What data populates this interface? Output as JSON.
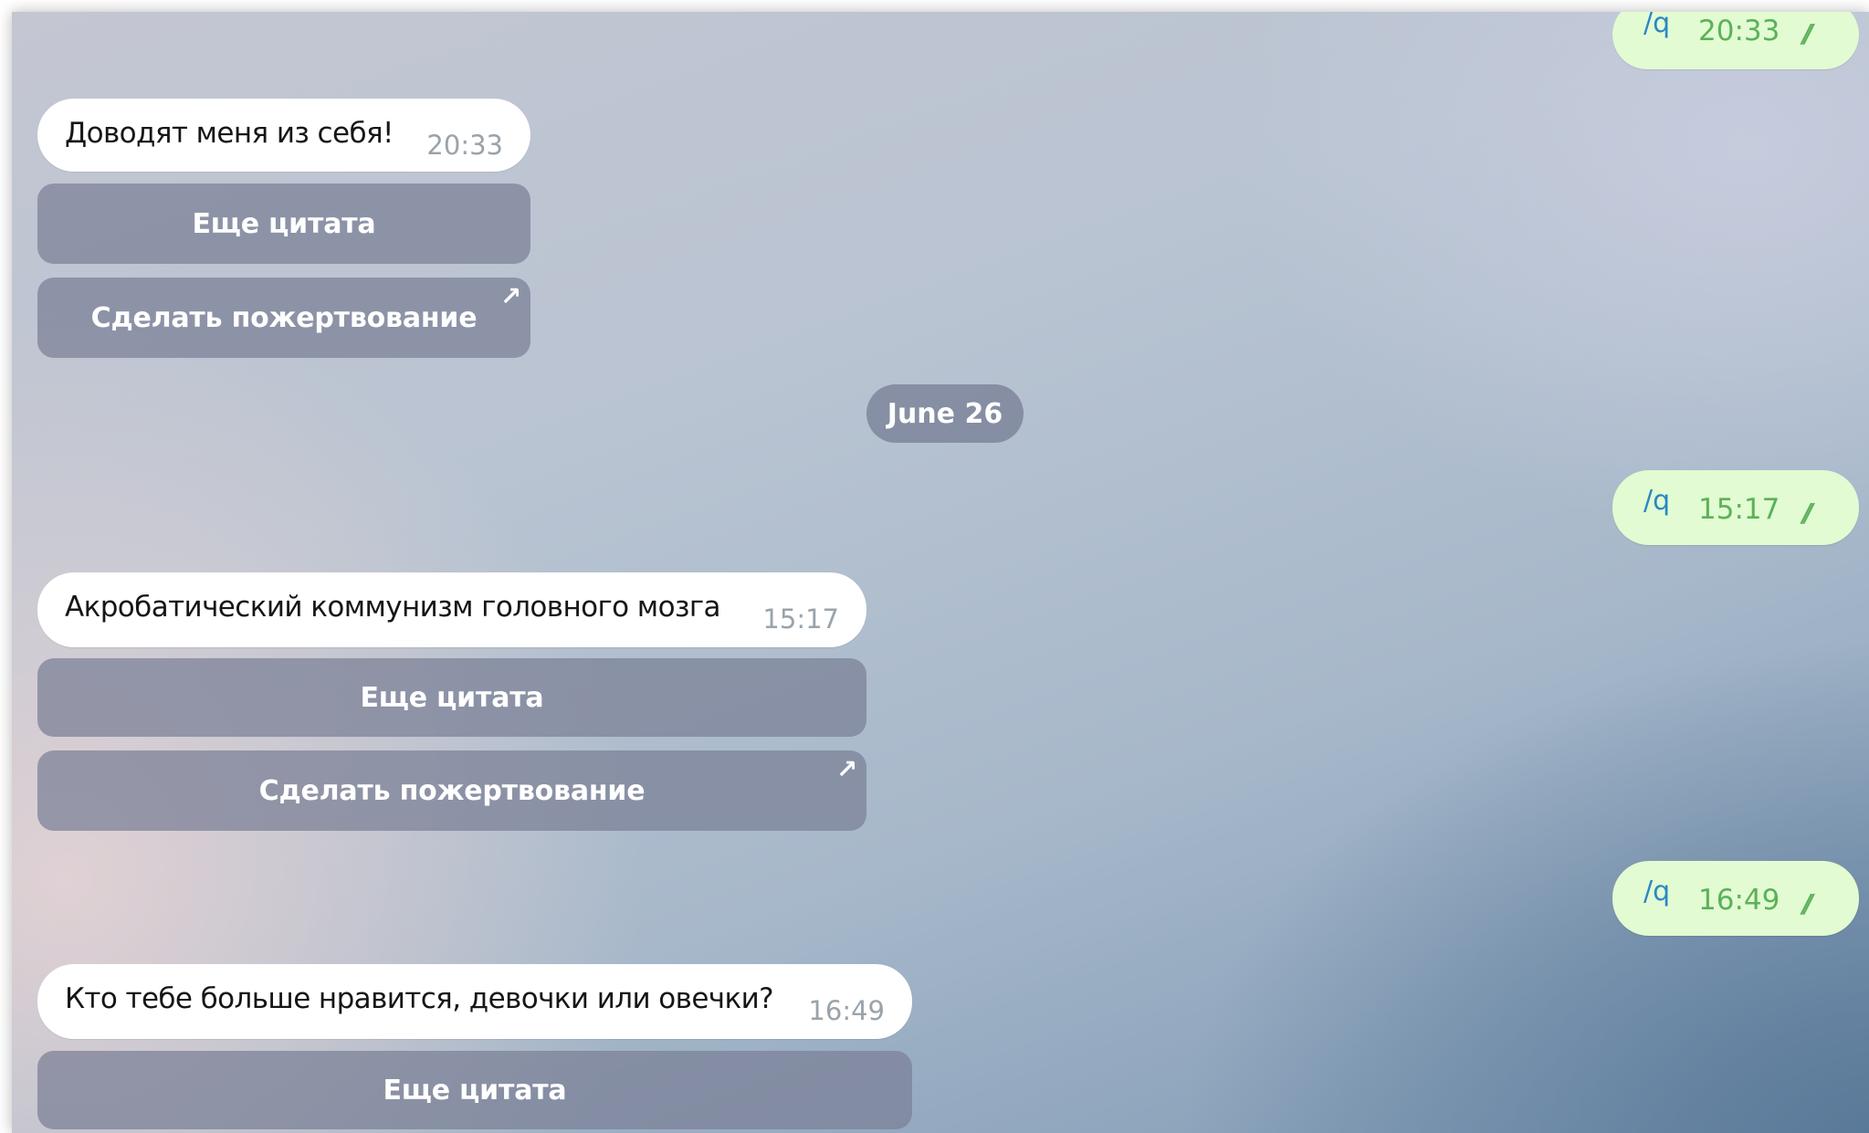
{
  "chat": {
    "top_outgoing": {
      "command": "/q",
      "time": "20:33",
      "status_icon": "double-check-icon"
    },
    "group1": {
      "message": {
        "text": "Доводят меня из себя!",
        "time": "20:33"
      },
      "buttons": [
        {
          "label": "Еще цитата"
        },
        {
          "label": "Сделать пожертвование",
          "icon": "external-link-arrow-icon",
          "icon_glyph": "↗"
        }
      ]
    },
    "date_separator": "June 26",
    "outgoing2": {
      "command": "/q",
      "time": "15:17",
      "status_icon": "double-check-icon"
    },
    "group2": {
      "message": {
        "text": "Акробатический коммунизм головного мозга",
        "time": "15:17"
      },
      "buttons": [
        {
          "label": "Еще цитата"
        },
        {
          "label": "Сделать пожертвование",
          "icon": "external-link-arrow-icon",
          "icon_glyph": "↗"
        }
      ]
    },
    "outgoing3": {
      "command": "/q",
      "time": "16:49",
      "status_icon": "double-check-icon"
    },
    "group3": {
      "message": {
        "text": "Кто тебе больше нравится, девочки или овечки?",
        "time": "16:49"
      },
      "buttons": [
        {
          "label": "Еще цитата"
        }
      ]
    },
    "checkmark_glyph": "//",
    "colors": {
      "outgoing_bubble": "#e2fbd2",
      "outgoing_time": "#5db15a",
      "command_link": "#2a87c6",
      "keyboard_button": "#7a8096"
    }
  }
}
